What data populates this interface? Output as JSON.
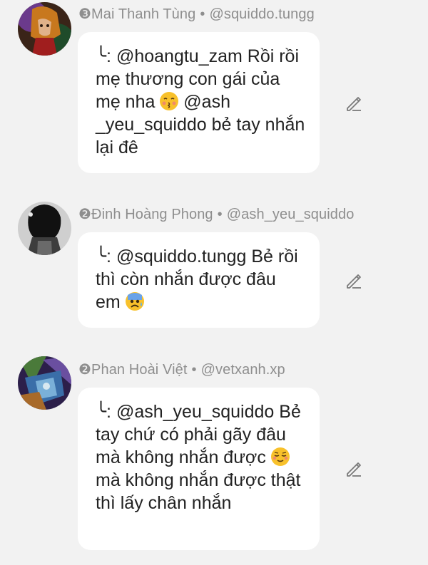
{
  "comments": [
    {
      "badge": "❸",
      "author": "Mai Thanh Tùng",
      "separator": "•",
      "handle": "@squiddo.tungg",
      "reply_arrow": "╰:",
      "text_part1": "@hoangtu_zam Rồi rồi mẹ thương con gái của mẹ nha",
      "emoji": "kissing-face-emoji",
      "text_part2": "@ash _yeu_squiddo bẻ tay nhắn lại đê"
    },
    {
      "badge": "❷",
      "author": "Đinh Hoàng Phong",
      "separator": "•",
      "handle": "@ash_yeu_squiddo",
      "reply_arrow": "╰:",
      "text_part1": "@squiddo.tungg Bẻ rồi thì còn nhắn được đâu em",
      "emoji": "anxious-face-emoji",
      "text_part2": ""
    },
    {
      "badge": "❷",
      "author": "Phan Hoài Việt",
      "separator": "•",
      "handle": "@vetxanh.xp",
      "reply_arrow": "╰:",
      "text_part1": "@ash_yeu_squiddo Bẻ tay chứ có phải gãy đâu mà không nhắn được",
      "emoji": "relieved-face-emoji",
      "text_part2": "mà không nhắn được thật thì lấy chân nhắn"
    }
  ],
  "colors": {
    "background": "#f2f2f2",
    "bubble": "#ffffff",
    "meta_text": "#8e8e8e",
    "body_text": "#222222",
    "emoji_yellow": "#f8c12b"
  }
}
